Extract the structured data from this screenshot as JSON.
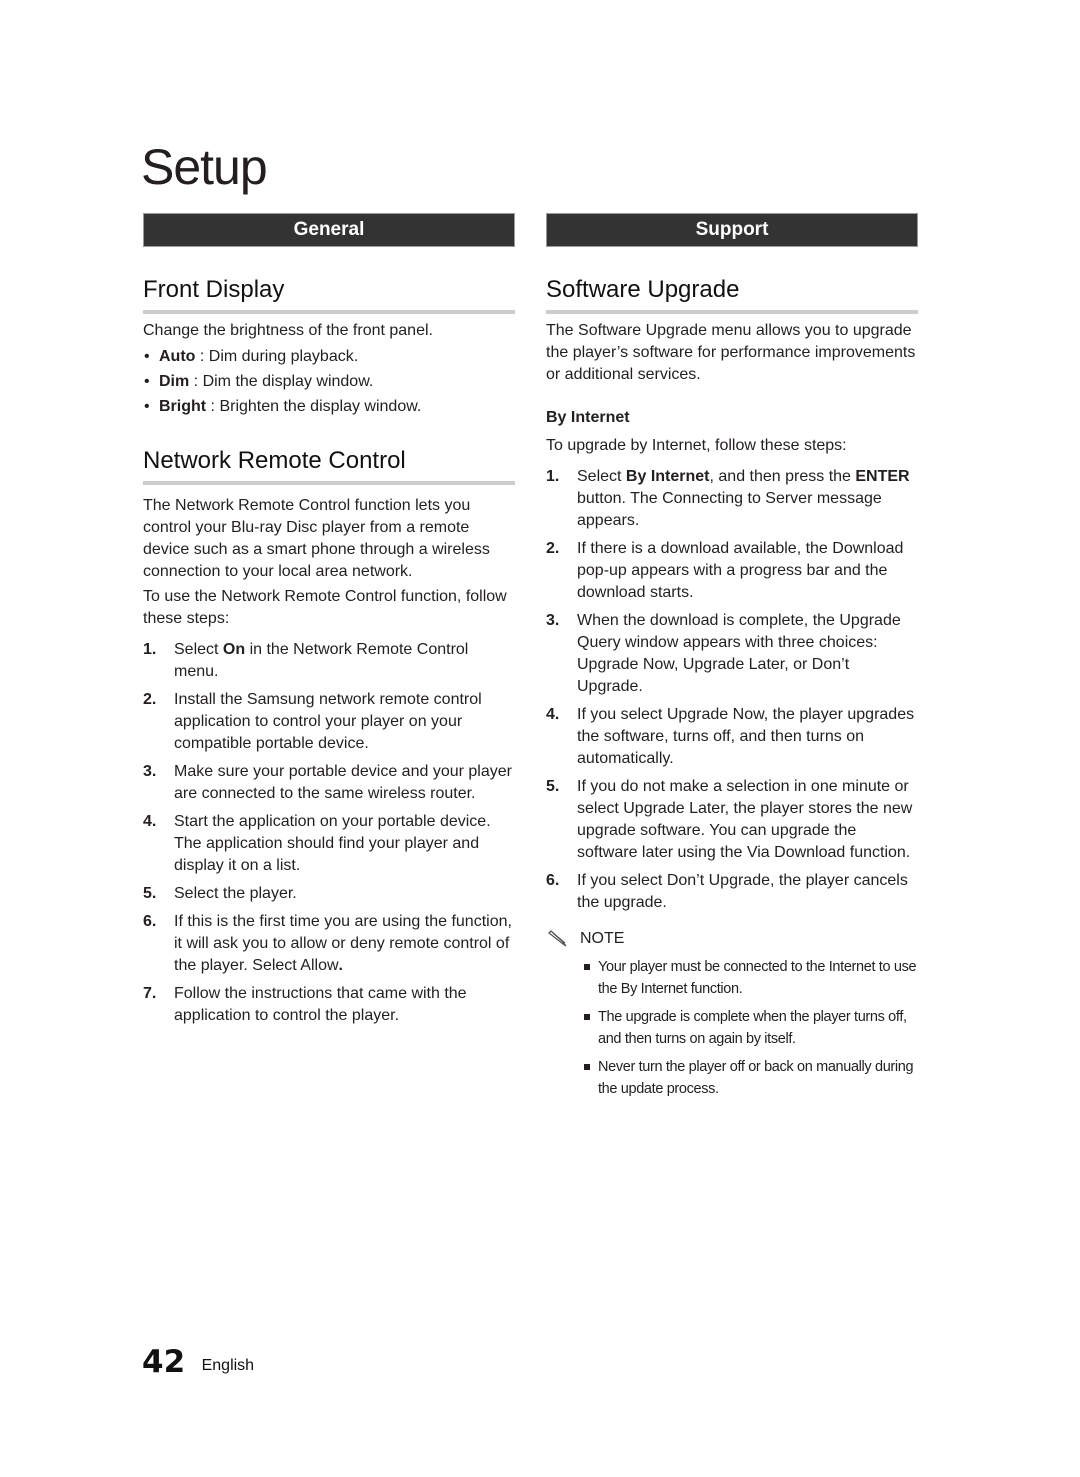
{
  "page": {
    "title": "Setup",
    "page_number": "42",
    "language": "English"
  },
  "left_column": {
    "section_bar": "General",
    "front_display": {
      "heading": "Front Display",
      "intro": "Change the brightness of the front panel.",
      "options": [
        {
          "term": "Auto",
          "desc": " : Dim during playback."
        },
        {
          "term": "Dim",
          "desc": " : Dim the display window."
        },
        {
          "term": "Bright",
          "desc": " : Brighten the display window."
        }
      ]
    },
    "network_remote": {
      "heading": "Network Remote Control",
      "intro": "The Network Remote Control function lets you control your Blu-ray Disc player from a remote device such as a smart phone through a wireless connection to your local area network.",
      "lead": "To use the Network Remote Control function, follow these steps:",
      "steps": [
        {
          "num": "1.",
          "pre": "Select ",
          "bold": "On",
          "post": " in the Network Remote Control menu."
        },
        {
          "num": "2.",
          "pre": "Install the Samsung network remote control application to control your player on your compatible portable device.",
          "bold": "",
          "post": ""
        },
        {
          "num": "3.",
          "pre": "Make sure your portable device and your player are connected to the same wireless router.",
          "bold": "",
          "post": ""
        },
        {
          "num": "4.",
          "pre": "Start the application on your portable device. The application should find your player and display it on a list.",
          "bold": "",
          "post": ""
        },
        {
          "num": "5.",
          "pre": "Select the player.",
          "bold": "",
          "post": ""
        },
        {
          "num": "6.",
          "pre": "If this is the first time you are using the function, it will ask you to allow or deny remote control of the player. Select Allow",
          "bold": ".",
          "post": ""
        },
        {
          "num": "7.",
          "pre": "Follow the instructions that came with the application to control the player.",
          "bold": "",
          "post": ""
        }
      ]
    }
  },
  "right_column": {
    "section_bar": "Support",
    "software_upgrade": {
      "heading": "Software Upgrade",
      "intro": "The Software Upgrade menu allows you to upgrade the player’s software for performance improvements or additional services.",
      "subheading": "By Internet",
      "lead": "To upgrade by Internet, follow these steps:",
      "steps": [
        {
          "num": "1.",
          "pre": "Select ",
          "bold": "By Internet",
          "mid": ", and then press the ",
          "bold2": "ENTER",
          "post": " button. The Connecting to Server message appears."
        },
        {
          "num": "2.",
          "pre": "If there is a download available, the Download pop-up appears with a progress bar and the download starts.",
          "bold": "",
          "mid": "",
          "bold2": "",
          "post": ""
        },
        {
          "num": "3.",
          "pre": "When the download is complete, the Upgrade Query window appears with three choices: Upgrade Now, Upgrade Later, or Don’t Upgrade.",
          "bold": "",
          "mid": "",
          "bold2": "",
          "post": ""
        },
        {
          "num": "4.",
          "pre": "If you select Upgrade Now, the player upgrades the software, turns off, and then turns on automatically.",
          "bold": "",
          "mid": "",
          "bold2": "",
          "post": ""
        },
        {
          "num": "5.",
          "pre": "If you do not make a selection in one minute or select Upgrade Later, the player stores the new upgrade software. You can upgrade the software later using the Via Download function.",
          "bold": "",
          "mid": "",
          "bold2": "",
          "post": ""
        },
        {
          "num": "6.",
          "pre": "If you select Don’t Upgrade, the player cancels the upgrade.",
          "bold": "",
          "mid": "",
          "bold2": "",
          "post": ""
        }
      ],
      "note": {
        "icon": "pencil-icon",
        "label": "NOTE",
        "items": [
          "Your player must be connected to the Internet to use the By Internet function.",
          "The upgrade is complete when the player turns off, and then turns on again by itself.",
          "Never turn the player off or back on manually during the update process."
        ]
      }
    }
  }
}
